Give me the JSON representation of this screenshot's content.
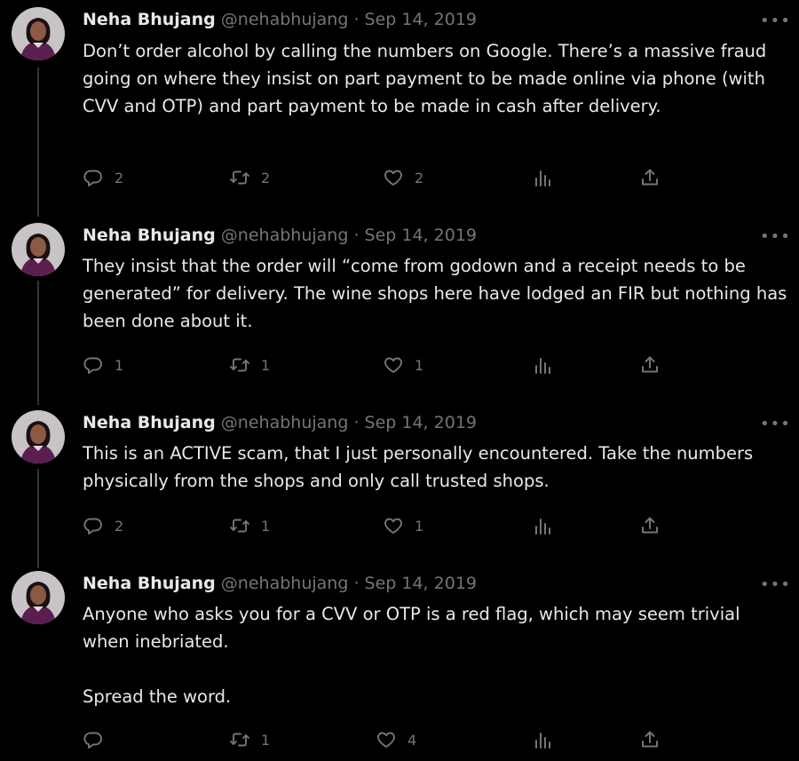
{
  "author": {
    "name": "Neha Bhujang",
    "handle": "@nehabhujang",
    "separator": "·"
  },
  "more_label": "•••",
  "tweets": [
    {
      "date": "Sep 14, 2019",
      "text": [
        "Don’t order alcohol by calling the numbers on Google. There’s a massive fraud going on where they insist on part payment to be made online via phone (with CVV and OTP) and part payment to be made in cash after delivery."
      ],
      "replies": "2",
      "retweets": "2",
      "likes": "2"
    },
    {
      "date": "Sep 14, 2019",
      "text": [
        "They insist that the order will “come from godown and a receipt needs to be generated” for delivery. The wine shops here have lodged an FIR but nothing has been done about it."
      ],
      "replies": "1",
      "retweets": "1",
      "likes": "1"
    },
    {
      "date": "Sep 14, 2019",
      "text": [
        "This is an ACTIVE scam, that I just personally encountered. Take the numbers physically from the shops and only call trusted shops."
      ],
      "replies": "2",
      "retweets": "1",
      "likes": "1"
    },
    {
      "date": "Sep 14, 2019",
      "text": [
        "Anyone who asks you for a CVV or OTP is a red flag, which may seem trivial when inebriated.",
        "Spread the word."
      ],
      "replies": "",
      "retweets": "1",
      "likes": "4"
    }
  ],
  "colors": {
    "background": "#000000",
    "text": "#e7e9ea",
    "muted": "#71767b",
    "thread_line": "#333639"
  },
  "icons": [
    "reply-icon",
    "retweet-icon",
    "like-icon",
    "views-icon",
    "share-icon",
    "more-icon"
  ]
}
